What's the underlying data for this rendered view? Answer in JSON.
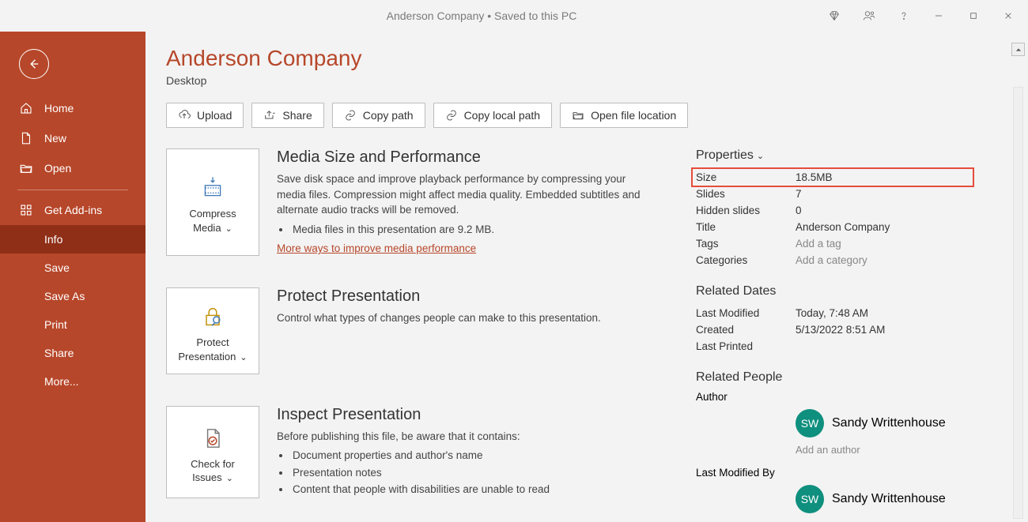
{
  "titlebar": {
    "title": "Anderson Company • Saved to this PC"
  },
  "sidebar": {
    "home": "Home",
    "new": "New",
    "open": "Open",
    "addins": "Get Add-ins",
    "info": "Info",
    "save": "Save",
    "saveas": "Save As",
    "print": "Print",
    "share": "Share",
    "more": "More..."
  },
  "doc": {
    "title": "Anderson Company",
    "location": "Desktop"
  },
  "actions": {
    "upload": "Upload",
    "share": "Share",
    "copypath": "Copy path",
    "copylocal": "Copy local path",
    "openloc": "Open file location"
  },
  "blocks": {
    "media": {
      "btn1": "Compress",
      "btn2": "Media",
      "title": "Media Size and Performance",
      "desc": "Save disk space and improve playback performance by compressing your media files. Compression might affect media quality. Embedded subtitles and alternate audio tracks will be removed.",
      "bullet1": "Media files in this presentation are 9.2 MB.",
      "link": "More ways to improve media performance"
    },
    "protect": {
      "btn1": "Protect",
      "btn2": "Presentation",
      "title": "Protect Presentation",
      "desc": "Control what types of changes people can make to this presentation."
    },
    "inspect": {
      "btn1": "Check for",
      "btn2": "Issues",
      "title": "Inspect Presentation",
      "desc": "Before publishing this file, be aware that it contains:",
      "b1": "Document properties and author's name",
      "b2": "Presentation notes",
      "b3": "Content that people with disabilities are unable to read"
    }
  },
  "props": {
    "head": "Properties",
    "size_k": "Size",
    "size_v": "18.5MB",
    "slides_k": "Slides",
    "slides_v": "7",
    "hidden_k": "Hidden slides",
    "hidden_v": "0",
    "title_k": "Title",
    "title_v": "Anderson Company",
    "tags_k": "Tags",
    "tags_v": "Add a tag",
    "cat_k": "Categories",
    "cat_v": "Add a category"
  },
  "dates": {
    "head": "Related Dates",
    "mod_k": "Last Modified",
    "mod_v": "Today, 7:48 AM",
    "created_k": "Created",
    "created_v": "5/13/2022 8:51 AM",
    "printed_k": "Last Printed"
  },
  "people": {
    "head": "Related People",
    "author_k": "Author",
    "initials": "SW",
    "name": "Sandy Writtenhouse",
    "add": "Add an author",
    "modby_k": "Last Modified By"
  }
}
